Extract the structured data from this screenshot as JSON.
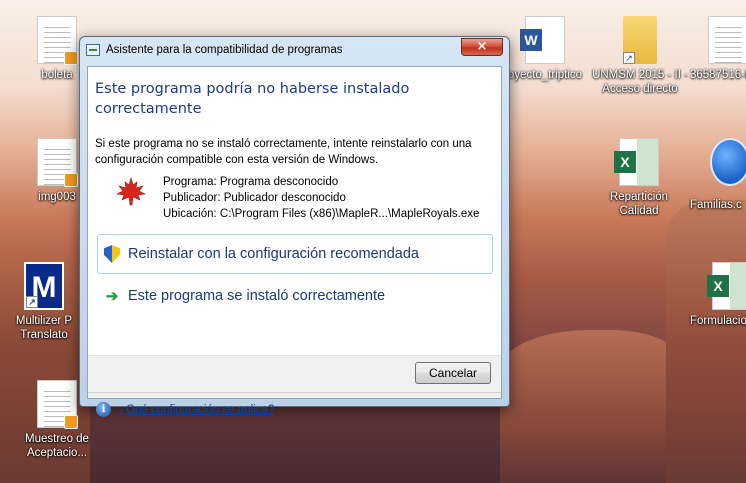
{
  "desktop": {
    "icons": [
      {
        "id": "boleta",
        "label": "boleta"
      },
      {
        "id": "img003",
        "label": "img003"
      },
      {
        "id": "multilizer",
        "label": "Multilizer P Translato"
      },
      {
        "id": "muestreo",
        "label": "Muestreo de Aceptacio..."
      },
      {
        "id": "proyecto",
        "label": "oyecto_triptico"
      },
      {
        "id": "unmsm",
        "label": "UNMSM 2015 - II - Acceso directo"
      },
      {
        "id": "doc365",
        "label": "36587516-I"
      },
      {
        "id": "reparticion",
        "label": "Repartición Calidad"
      },
      {
        "id": "familias",
        "label": "Familias.c"
      },
      {
        "id": "formulacion",
        "label": "Formulacio"
      }
    ]
  },
  "dialog": {
    "title": "Asistente para la compatibilidad de programas",
    "close_symbol": "×",
    "heading": "Este programa podría no haberse instalado correctamente",
    "intro": "Si este programa no se instaló correctamente, intente reinstalarlo con una configuración compatible con esta versión de Windows.",
    "program_line": "Programa: Programa desconocido",
    "publisher_line": "Publicador: Publicador desconocido",
    "location_line": "Ubicación: C:\\Program Files (x86)\\MapleR...\\MapleRoyals.exe",
    "option_reinstall": "Reinstalar con la configuración recomendada",
    "option_installed_ok": "Este programa se instaló correctamente",
    "cancel_label": "Cancelar",
    "help_link": "¿Qué configuración se aplica?"
  }
}
